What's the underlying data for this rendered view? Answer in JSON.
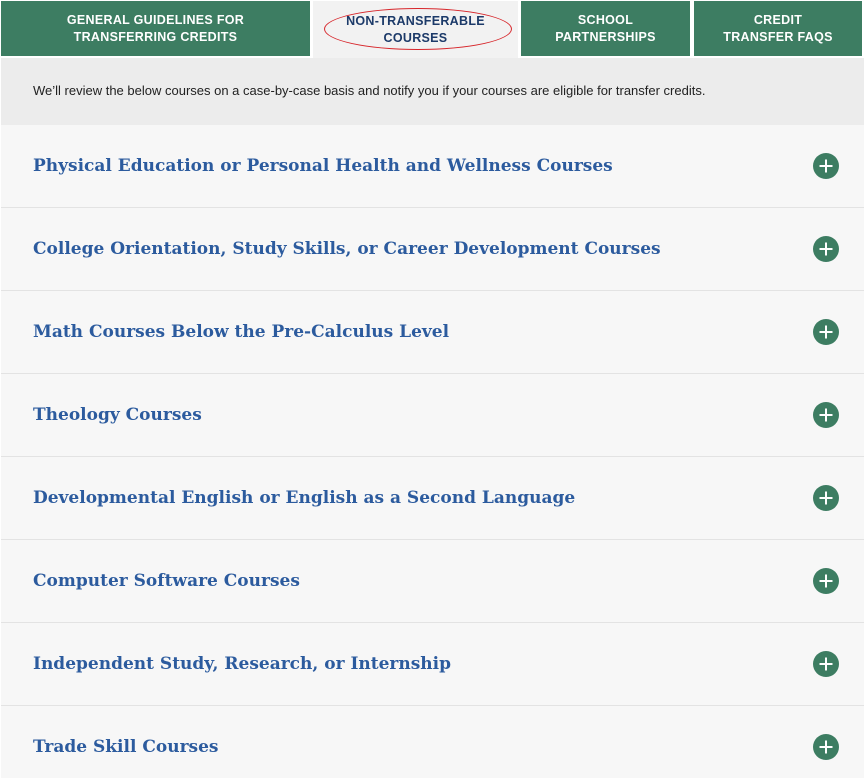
{
  "tabs": [
    {
      "line1": "GENERAL GUIDELINES FOR",
      "line2": "TRANSFERRING CREDITS",
      "active": false
    },
    {
      "line1": "NON-TRANSFERABLE",
      "line2": "COURSES",
      "active": true
    },
    {
      "line1": "SCHOOL",
      "line2": "PARTNERSHIPS",
      "active": false
    },
    {
      "line1": "CREDIT",
      "line2": "TRANSFER FAQS",
      "active": false
    }
  ],
  "intro": {
    "text": "We’ll review the below courses on a case-by-case basis and notify you if your courses are eligible for transfer credits."
  },
  "courses": [
    {
      "title": "Physical Education or Personal Health and Wellness Courses",
      "icon": "plus-circle-icon"
    },
    {
      "title": "College Orientation, Study Skills, or Career Development Courses",
      "icon": "plus-circle-icon"
    },
    {
      "title": "Math Courses Below the Pre-Calculus Level",
      "icon": "plus-circle-icon"
    },
    {
      "title": "Theology Courses",
      "icon": "plus-circle-icon"
    },
    {
      "title": "Developmental English or English as a Second Language",
      "icon": "plus-circle-icon"
    },
    {
      "title": "Computer Software Courses",
      "icon": "plus-circle-icon"
    },
    {
      "title": "Independent Study, Research, or Internship",
      "icon": "plus-circle-icon"
    },
    {
      "title": "Trade Skill Courses",
      "icon": "plus-circle-icon"
    }
  ],
  "colors": {
    "tab_green": "#3d7d62",
    "active_tab_text": "#1c3a69",
    "course_title": "#2c5b9e",
    "annotation_red": "#d7262b"
  }
}
